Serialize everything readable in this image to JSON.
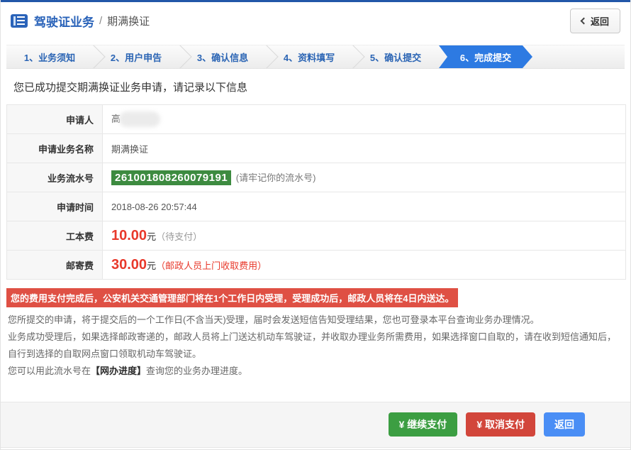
{
  "header": {
    "title": "驾驶证业务",
    "separator": "/",
    "subtitle": "期满换证",
    "back_label": "返回"
  },
  "steps": [
    "1、业务须知",
    "2、用户申告",
    "3、确认信息",
    "4、资料填写",
    "5、确认提交",
    "6、完成提交"
  ],
  "active_step_index": 5,
  "success_message": "您已成功提交期满换证业务申请，请记录以下信息",
  "info_table": {
    "applicant": {
      "label": "申请人",
      "value": "高"
    },
    "business_name": {
      "label": "申请业务名称",
      "value": "期满换证"
    },
    "serial": {
      "label": "业务流水号",
      "number": "261001808260079191",
      "note": "(请牢记你的流水号)"
    },
    "apply_time": {
      "label": "申请时间",
      "value": "2018-08-26 20:57:44"
    },
    "work_fee": {
      "label": "工本费",
      "amount": "10.00",
      "unit": "元",
      "note": "（待支付）"
    },
    "post_fee": {
      "label": "邮寄费",
      "amount": "30.00",
      "unit": "元",
      "note": "（邮政人员上门收取费用）"
    }
  },
  "warning_banner": "您的费用支付完成后，公安机关交通管理部门将在1个工作日内受理，受理成功后，邮政人员将在4日内送达。",
  "notes": {
    "p1": "您所提交的申请，将于提交后的一个工作日(不含当天)受理，届时会发送短信告知受理结果，您也可登录本平台查询业务办理情况。",
    "p2": "业务成功受理后，如果选择邮政寄递的，邮政人员将上门送达机动车驾驶证，并收取办理业务所需费用，如果选择窗口自取的，请在收到短信通知后，自行到选择的自取网点窗口领取机动车驾驶证。",
    "p3_prefix": "您可以用此流水号在",
    "p3_highlight": "【网办进度】",
    "p3_suffix": "查询您的业务办理进度。"
  },
  "footer": {
    "continue_pay": "¥ 继续支付",
    "cancel_pay": "¥ 取消支付",
    "back": "返回"
  },
  "colors": {
    "topbar_blue": "#2257a8",
    "title_blue": "#2a63b9",
    "active_step_blue": "#2d7ae2",
    "serial_green": "#3d8b40",
    "amount_red": "#e8392b",
    "banner_red": "#df5044",
    "btn_green": "#3c9e42",
    "btn_red": "#d2463b",
    "btn_blue": "#4a8ef5"
  }
}
